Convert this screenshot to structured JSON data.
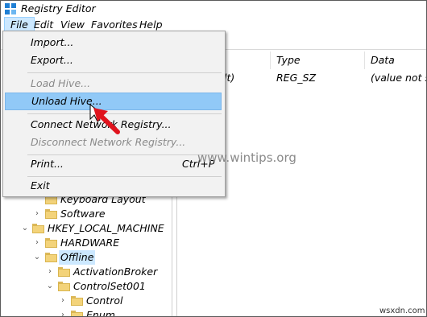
{
  "window": {
    "title": "Registry Editor"
  },
  "menubar": [
    "File",
    "Edit",
    "View",
    "Favorites",
    "Help"
  ],
  "file_menu": {
    "items": [
      {
        "label": "Import...",
        "shortcut": "",
        "disabled": false,
        "highlighted": false
      },
      {
        "label": "Export...",
        "shortcut": "",
        "disabled": false,
        "highlighted": false
      },
      {
        "label": "Load Hive...",
        "shortcut": "",
        "disabled": true,
        "highlighted": false
      },
      {
        "label": "Unload Hive...",
        "shortcut": "",
        "disabled": false,
        "highlighted": true
      },
      {
        "label": "Connect Network Registry...",
        "shortcut": "",
        "disabled": false,
        "highlighted": false
      },
      {
        "label": "Disconnect Network Registry...",
        "shortcut": "",
        "disabled": true,
        "highlighted": false
      },
      {
        "label": "Print...",
        "shortcut": "Ctrl+P",
        "disabled": false,
        "highlighted": false
      },
      {
        "label": "Exit",
        "shortcut": "",
        "disabled": false,
        "highlighted": false
      }
    ]
  },
  "list": {
    "columns": [
      "Type",
      "Data"
    ],
    "rows": [
      {
        "name_fragment": "lt)",
        "type": "REG_SZ",
        "data": "(value not set)"
      }
    ]
  },
  "tree": {
    "items": [
      {
        "label": "Keyboard Layout",
        "selected": false
      },
      {
        "label": "Software",
        "selected": false
      },
      {
        "label": "HKEY_LOCAL_MACHINE",
        "selected": false
      },
      {
        "label": "HARDWARE",
        "selected": false
      },
      {
        "label": "Offline",
        "selected": true
      },
      {
        "label": "ActivationBroker",
        "selected": false
      },
      {
        "label": "ControlSet001",
        "selected": false
      },
      {
        "label": "Control",
        "selected": false
      },
      {
        "label": "Enum",
        "selected": false
      }
    ]
  },
  "watermark": "www.wintips.org",
  "footer_mark": "wsxdn.com",
  "colors": {
    "menu_highlight": "#91c9f7",
    "menubar_active": "#cce8ff",
    "folder": "#f3d37a",
    "cursor": "#e0141e"
  }
}
